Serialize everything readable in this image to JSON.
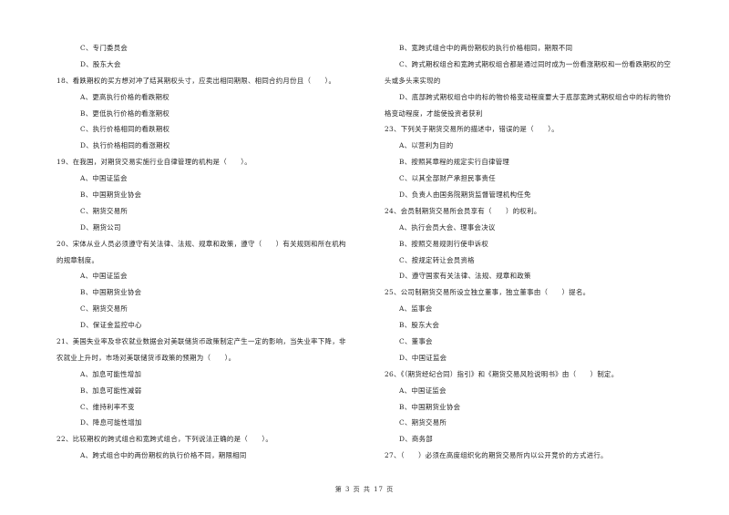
{
  "page": {
    "footer": "第 3 页 共 17 页"
  },
  "left_column": {
    "lines": [
      {
        "type": "option",
        "text": "C、专门委员会"
      },
      {
        "type": "option",
        "text": "D、股东大会"
      },
      {
        "type": "question",
        "text": "18、看跌期权的买方想对冲了结其期权头寸，应卖出相同期限、相同合约月份且（　　）。"
      },
      {
        "type": "option",
        "text": "A、更高执行价格的看跌期权"
      },
      {
        "type": "option",
        "text": "B、更低执行价格的看涨期权"
      },
      {
        "type": "option",
        "text": "C、执行价格相同的看跌期权"
      },
      {
        "type": "option",
        "text": "D、执行价格相同的看涨期权"
      },
      {
        "type": "question",
        "text": "19、在我国，对期货交易实施行业自律管理的机构是（　　）。"
      },
      {
        "type": "option",
        "text": "A、中国证监会"
      },
      {
        "type": "option",
        "text": "B、中国期货业协会"
      },
      {
        "type": "option",
        "text": "C、期货交易所"
      },
      {
        "type": "option",
        "text": "D、期货公司"
      },
      {
        "type": "question",
        "text": "20、宋体从业人员必须遵守有关法律、法规、规章和政策，遵守（　　）有关规则和所在机构"
      },
      {
        "type": "continuation",
        "text": "的规章制度。"
      },
      {
        "type": "option",
        "text": "A、中国证监会"
      },
      {
        "type": "option",
        "text": "B、中国期货业协会"
      },
      {
        "type": "option",
        "text": "C、期货交易所"
      },
      {
        "type": "option",
        "text": "D、保证金监控中心"
      },
      {
        "type": "question",
        "text": "21、美国失业率及非农就业数据会对美联储货币政策制定产生一定的影响，当失业率下降，非"
      },
      {
        "type": "continuation",
        "text": "农就业上升时，市场对美联储货币政策的预期为（　　）。"
      },
      {
        "type": "option",
        "text": "A、加息可能性增加"
      },
      {
        "type": "option",
        "text": "B、加息可能性减弱"
      },
      {
        "type": "option",
        "text": "C、维持利率不变"
      },
      {
        "type": "option",
        "text": "D、降息可能性增加"
      },
      {
        "type": "question",
        "text": "22、比较期权的跨式组合和宽跨式组合，下列说法正确的是（　　）。"
      },
      {
        "type": "option",
        "text": "A、跨式组合中的两份期权的执行价格不同，期限相同"
      }
    ]
  },
  "right_column": {
    "lines": [
      {
        "type": "option",
        "text": "B、宽跨式组合中的两份期权的执行价格相同，期限不同"
      },
      {
        "type": "option",
        "text": "C、跨式期权组合和宽跨式期权组合都是通过同时成为一份看涨期权和一份看跌期权的空"
      },
      {
        "type": "continuation",
        "text": "头或多头来实现的"
      },
      {
        "type": "option",
        "text": "D、底部跨式期权组合中的标的物价格变动程度要大于底部宽跨式期权组合中的标的物价"
      },
      {
        "type": "continuation",
        "text": "格变动程度，才能使投资者获利"
      },
      {
        "type": "question",
        "text": "23、下列关于期货交易所的描述中，错误的是（　　）。"
      },
      {
        "type": "option",
        "text": "A、以营利为目的"
      },
      {
        "type": "option",
        "text": "B、按照其章程的规定实行自律管理"
      },
      {
        "type": "option",
        "text": "C、以其全部财产承担民事责任"
      },
      {
        "type": "option",
        "text": "D、负责人由国务院期货监督管理机构任免"
      },
      {
        "type": "question",
        "text": "24、会员制期货交易所会员享有（　　）的权利。"
      },
      {
        "type": "option",
        "text": "A、执行会员大会、理事会决议"
      },
      {
        "type": "option",
        "text": "B、按照交易规则行使申诉权"
      },
      {
        "type": "option",
        "text": "C、按规定转让会员资格"
      },
      {
        "type": "option",
        "text": "D、遵守国家有关法律、法规、规章和政策"
      },
      {
        "type": "question",
        "text": "25、公司制期货交易所设立独立董事，独立董事由（　　）提名。"
      },
      {
        "type": "option",
        "text": "A、监事会"
      },
      {
        "type": "option",
        "text": "B、股东大会"
      },
      {
        "type": "option",
        "text": "C、董事会"
      },
      {
        "type": "option",
        "text": "D、中国证监会"
      },
      {
        "type": "question",
        "text": "26、《（期货经纪合同）指引》和《期货交易风险说明书》由（　　）制定。"
      },
      {
        "type": "option",
        "text": "A、中国证监会"
      },
      {
        "type": "option",
        "text": "B、中国期货业协会"
      },
      {
        "type": "option",
        "text": "C、期货交易所"
      },
      {
        "type": "option",
        "text": "D、商务部"
      },
      {
        "type": "question",
        "text": "27、（　　）必须在高度组织化的期货交易所内以公开竞价的方式进行。"
      }
    ]
  }
}
